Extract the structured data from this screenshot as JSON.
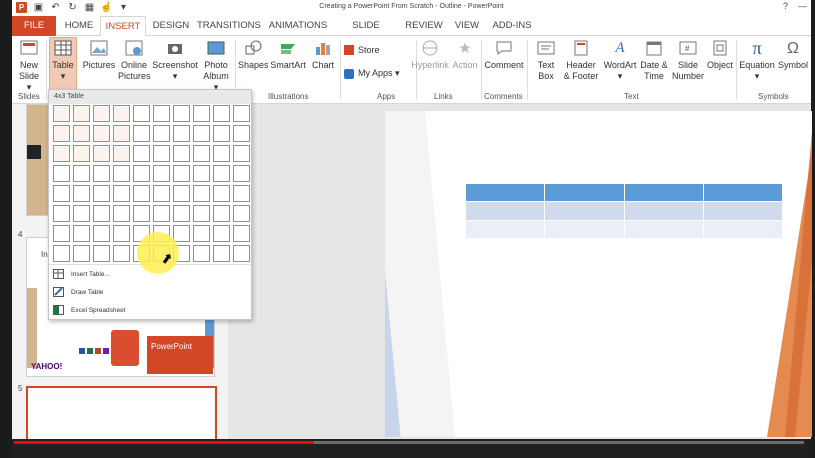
{
  "window": {
    "title": "Creating a PowerPoint From Scratch - Outline - PowerPoint"
  },
  "tabs": [
    "FILE",
    "HOME",
    "INSERT",
    "DESIGN",
    "TRANSITIONS",
    "ANIMATIONS",
    "SLIDE SHOW",
    "REVIEW",
    "VIEW",
    "ADD-INS"
  ],
  "active_tab": "INSERT",
  "ribbon": {
    "new_slide": [
      "New",
      "Slide ▾"
    ],
    "table": [
      "Table",
      "▾"
    ],
    "pictures": "Pictures",
    "online_pictures": [
      "Online",
      "Pictures"
    ],
    "screenshot": [
      "Screenshot",
      "▾"
    ],
    "photo_album": [
      "Photo",
      "Album ▾"
    ],
    "shapes": "Shapes",
    "smartart": "SmartArt",
    "chart": "Chart",
    "store": "Store",
    "my_apps": "My Apps ▾",
    "hyperlink": "Hyperlink",
    "action": "Action",
    "comment": "Comment",
    "text_box": [
      "Text",
      "Box"
    ],
    "header_footer": [
      "Header",
      "& Footer"
    ],
    "wordart": [
      "WordArt",
      "▾"
    ],
    "date_time": [
      "Date &",
      "Time"
    ],
    "slide_number": [
      "Slide",
      "Number"
    ],
    "object": "Object",
    "equation": [
      "Equation",
      "▾"
    ],
    "symbol": "Symbol",
    "groups": {
      "slides": "Slides",
      "illustrations": "Illustrations",
      "apps": "Apps",
      "links": "Links",
      "comments": "Comments",
      "text": "Text",
      "symbols": "Symbols"
    }
  },
  "table_dropdown": {
    "header": "4x3 Table",
    "grid_cols": 10,
    "grid_rows": 8,
    "selected_cols": 4,
    "selected_rows": 3,
    "items": [
      "Insert Table...",
      "Draw Table",
      "Excel Spreadsheet"
    ]
  },
  "slide_pane": {
    "slide_numbers": [
      "4",
      "5"
    ],
    "thumb4_snippets": [
      "In",
      "PowerPoint",
      "YAHOO!"
    ]
  },
  "colors": {
    "accent": "#d24726",
    "table_header": "#5b9bd5",
    "table_row1": "#d0dcee",
    "table_row2": "#e9eef7"
  },
  "video": {
    "progress": 0.38
  }
}
